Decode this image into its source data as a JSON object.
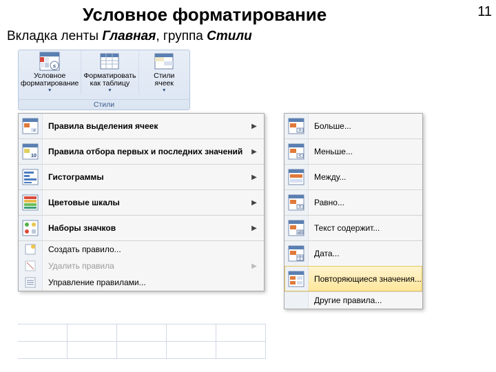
{
  "page": {
    "title": "Условное форматирование",
    "subtitle_prefix": "Вкладка ленты ",
    "subtitle_em1": "Главная",
    "subtitle_sep": ", группа ",
    "subtitle_em2": "Стили",
    "number": "11"
  },
  "ribbon": {
    "group_label": "Стили",
    "btn1_line1": "Условное",
    "btn1_line2": "форматирование",
    "btn2_line1": "Форматировать",
    "btn2_line2": "как таблицу",
    "btn3_line1": "Стили",
    "btn3_line2": "ячеек"
  },
  "menu_left": {
    "items": [
      {
        "label": "Правила выделения ячеек",
        "bold": true,
        "arrow": true
      },
      {
        "label": "Правила отбора первых и последних значений",
        "bold": true,
        "arrow": true
      },
      {
        "label": "Гистограммы",
        "bold": true,
        "arrow": true
      },
      {
        "label": "Цветовые шкалы",
        "bold": true,
        "arrow": true
      },
      {
        "label": "Наборы значков",
        "bold": true,
        "arrow": true
      }
    ],
    "small_items": [
      {
        "label": "Создать правило...",
        "disabled": false
      },
      {
        "label": "Удалить правила",
        "disabled": true,
        "arrow": true
      },
      {
        "label": "Управление правилами..."
      }
    ]
  },
  "menu_right": {
    "items": [
      {
        "label": "Больше..."
      },
      {
        "label": "Меньше..."
      },
      {
        "label": "Между..."
      },
      {
        "label": "Равно..."
      },
      {
        "label": "Текст содержит..."
      },
      {
        "label": "Дата..."
      },
      {
        "label": "Повторяющиеся значения...",
        "highlight": true
      }
    ],
    "footer": "Другие правила..."
  }
}
